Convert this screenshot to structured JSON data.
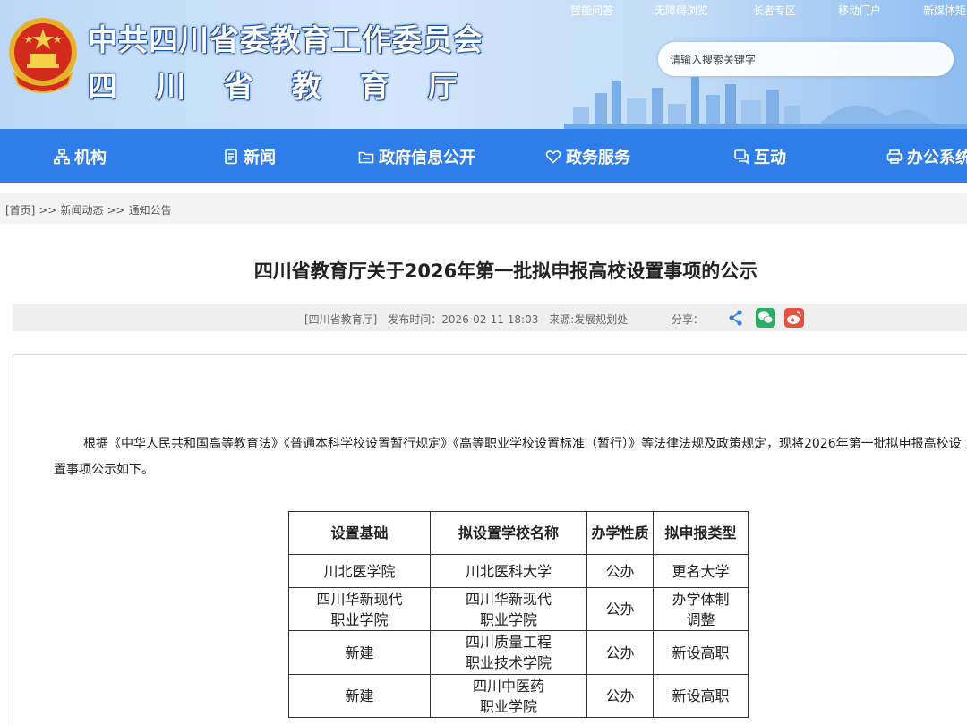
{
  "header": {
    "org_title": "中共四川省委教育工作委员会",
    "dept_title": "四川省教育厅",
    "top_links": [
      "智能问答",
      "无障碍浏览",
      "长者专区",
      "移动门户",
      "新媒体矩阵"
    ],
    "search": {
      "placeholder": "请输入搜索关键字"
    }
  },
  "nav": {
    "items": [
      {
        "label": "机构",
        "icon": "org-chart-icon"
      },
      {
        "label": "新闻",
        "icon": "news-icon"
      },
      {
        "label": "政府信息公开",
        "icon": "folder-icon"
      },
      {
        "label": "政务服务",
        "icon": "service-heart-icon"
      },
      {
        "label": "互动",
        "icon": "chat-icon"
      },
      {
        "label": "办公系统",
        "icon": "office-printer-icon"
      }
    ]
  },
  "breadcrumb": {
    "home": "[首页]",
    "sep": ">>",
    "level1": "新闻动态",
    "level2": "通知公告"
  },
  "article": {
    "title": "四川省教育厅关于2026年第一批拟申报高校设置事项的公示",
    "source_tag": "[四川省教育厅]",
    "publish": "发布时间：2026-02-11 18:03",
    "origin": "来源:发展规划处",
    "share_label": "分享：",
    "paragraph": "根据《中华人民共和国高等教育法》《普通本科学校设置暂行规定》《高等职业学校设置标准（暂行）》等法律法规及政策规定，现将2026年第一批拟申报高校设置事项公示如下。"
  },
  "table": {
    "headers": [
      "设置基础",
      "拟设置学校名称",
      "办学性质",
      "拟申报类型"
    ],
    "rows": [
      [
        "川北医学院",
        "川北医科大学",
        "公办",
        "更名大学"
      ],
      [
        "四川华新现代职业学院",
        "四川华新现代职业学院",
        "公办",
        "办学体制调整"
      ],
      [
        "新建",
        "四川质量工程职业技术学院",
        "公办",
        "新设高职"
      ],
      [
        "新建",
        "四川中医药职业学院",
        "公办",
        "新设高职"
      ]
    ]
  },
  "colors": {
    "nav_bg": "#2f7de8",
    "wechat": "#2aae67",
    "weibo": "#e6513f",
    "share": "#2f7de8"
  }
}
